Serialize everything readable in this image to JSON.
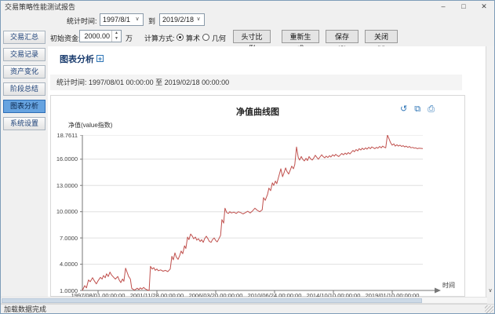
{
  "window": {
    "title": "交易策略性能测试报告",
    "controls": {
      "minimize": "–",
      "maximize": "□",
      "close": "✕"
    },
    "status": "加载数据完成"
  },
  "toolbar": {
    "stat_time_label": "统计时间:",
    "date_from": "1997/8/1",
    "to_label": "到",
    "date_to": "2019/2/18",
    "chevron": "∨",
    "initial_capital_label": "初始资金:",
    "initial_capital_value": "2000.00",
    "unit_label": "万",
    "calc_method_label": "计算方式:",
    "radio_arithmetic": "算术",
    "radio_geometric": "几何",
    "buttons": {
      "position_ratio": "头寸比例",
      "regenerate": "重新生成",
      "save": "保存(S)",
      "close": "关闭(X)"
    }
  },
  "sidebar": {
    "items": [
      {
        "label": "交易汇总",
        "selected": false
      },
      {
        "label": "交易记录",
        "selected": false
      },
      {
        "label": "资产变化",
        "selected": false
      },
      {
        "label": "阶段总结",
        "selected": false
      },
      {
        "label": "图表分析",
        "selected": true
      },
      {
        "label": "系统设置",
        "selected": false
      }
    ]
  },
  "main": {
    "section_title": "图表分析",
    "section_icon": "+",
    "stat_range": "统计时间: 1997/08/01 00:00:00 至 2019/02/18 00:00:00",
    "chart_icons": {
      "undo": "↺",
      "export": "⧉",
      "print": "⎙"
    }
  },
  "chart_data": {
    "type": "line",
    "title": "净值曲线图",
    "xlabel": "时间",
    "ylabel": "净值(value指数)",
    "x_tick_labels": [
      "1997/08/01 00:00:00",
      "2001/11/28 00:00:00",
      "2006/03/20 00:00:00",
      "2010/06/24 00:00:00",
      "2014/10/10 00:00:00",
      "2019/01/10 00:00:00"
    ],
    "y_ticks": [
      "1.0000",
      "4.0000",
      "7.0000",
      "10.0000",
      "13.0000",
      "16.0000",
      "18.7611"
    ],
    "ylim": [
      1.0,
      18.7611
    ],
    "grid": true,
    "legend": "none",
    "line_color": "#c0504d",
    "series": [
      {
        "name": "净值",
        "points": [
          [
            0.0,
            1.0
          ],
          [
            0.007,
            1.55
          ],
          [
            0.012,
            1.3
          ],
          [
            0.018,
            2.2
          ],
          [
            0.023,
            2.0
          ],
          [
            0.03,
            2.45
          ],
          [
            0.035,
            2.1
          ],
          [
            0.041,
            1.75
          ],
          [
            0.046,
            2.1
          ],
          [
            0.053,
            2.5
          ],
          [
            0.058,
            2.3
          ],
          [
            0.062,
            2.7
          ],
          [
            0.067,
            2.45
          ],
          [
            0.071,
            2.9
          ],
          [
            0.076,
            2.6
          ],
          [
            0.081,
            3.1
          ],
          [
            0.085,
            2.8
          ],
          [
            0.092,
            2.5
          ],
          [
            0.097,
            2.3
          ],
          [
            0.104,
            2.6
          ],
          [
            0.108,
            2.2
          ],
          [
            0.113,
            1.9
          ],
          [
            0.118,
            2.3
          ],
          [
            0.122,
            2.05
          ],
          [
            0.127,
            3.55
          ],
          [
            0.131,
            3.1
          ],
          [
            0.136,
            2.6
          ],
          [
            0.141,
            2.3
          ],
          [
            0.145,
            1.25
          ],
          [
            0.15,
            1.1
          ],
          [
            0.154,
            1.05
          ],
          [
            0.161,
            1.25
          ],
          [
            0.166,
            1.1
          ],
          [
            0.17,
            1.3
          ],
          [
            0.175,
            1.15
          ],
          [
            0.18,
            1.35
          ],
          [
            0.184,
            1.2
          ],
          [
            0.191,
            1.05
          ],
          [
            0.196,
            1.0
          ],
          [
            0.2,
            3.75
          ],
          [
            0.205,
            3.45
          ],
          [
            0.21,
            3.6
          ],
          [
            0.214,
            3.3
          ],
          [
            0.219,
            3.45
          ],
          [
            0.223,
            3.25
          ],
          [
            0.23,
            3.35
          ],
          [
            0.237,
            3.2
          ],
          [
            0.244,
            3.3
          ],
          [
            0.251,
            3.15
          ],
          [
            0.258,
            3.45
          ],
          [
            0.263,
            4.9
          ],
          [
            0.267,
            4.5
          ],
          [
            0.272,
            5.3
          ],
          [
            0.276,
            4.8
          ],
          [
            0.281,
            4.55
          ],
          [
            0.286,
            5.0
          ],
          [
            0.29,
            5.5
          ],
          [
            0.295,
            5.2
          ],
          [
            0.3,
            6.1
          ],
          [
            0.304,
            5.8
          ],
          [
            0.309,
            7.1
          ],
          [
            0.313,
            6.8
          ],
          [
            0.318,
            7.45
          ],
          [
            0.323,
            7.2
          ],
          [
            0.327,
            6.9
          ],
          [
            0.332,
            7.1
          ],
          [
            0.336,
            6.75
          ],
          [
            0.341,
            6.9
          ],
          [
            0.346,
            6.6
          ],
          [
            0.35,
            6.8
          ],
          [
            0.355,
            6.5
          ],
          [
            0.359,
            6.9
          ],
          [
            0.364,
            7.2
          ],
          [
            0.369,
            6.9
          ],
          [
            0.373,
            6.6
          ],
          [
            0.378,
            6.5
          ],
          [
            0.382,
            6.8
          ],
          [
            0.387,
            7.0
          ],
          [
            0.392,
            6.7
          ],
          [
            0.396,
            6.55
          ],
          [
            0.401,
            6.9
          ],
          [
            0.406,
            7.3
          ],
          [
            0.41,
            9.1
          ],
          [
            0.415,
            8.7
          ],
          [
            0.419,
            10.4
          ],
          [
            0.424,
            9.9
          ],
          [
            0.429,
            9.8
          ],
          [
            0.433,
            10.0
          ],
          [
            0.438,
            9.85
          ],
          [
            0.445,
            9.95
          ],
          [
            0.452,
            9.8
          ],
          [
            0.458,
            10.0
          ],
          [
            0.465,
            9.9
          ],
          [
            0.472,
            9.75
          ],
          [
            0.479,
            9.9
          ],
          [
            0.486,
            10.05
          ],
          [
            0.493,
            9.85
          ],
          [
            0.5,
            10.1
          ],
          [
            0.507,
            10.4
          ],
          [
            0.514,
            10.15
          ],
          [
            0.521,
            10.0
          ],
          [
            0.528,
            10.2
          ],
          [
            0.532,
            11.6
          ],
          [
            0.537,
            11.3
          ],
          [
            0.544,
            12.0
          ],
          [
            0.548,
            12.7
          ],
          [
            0.553,
            12.4
          ],
          [
            0.558,
            13.3
          ],
          [
            0.562,
            13.0
          ],
          [
            0.567,
            13.5
          ],
          [
            0.571,
            13.2
          ],
          [
            0.578,
            14.2
          ],
          [
            0.583,
            14.9
          ],
          [
            0.588,
            14.0
          ],
          [
            0.592,
            14.4
          ],
          [
            0.597,
            15.0
          ],
          [
            0.601,
            14.6
          ],
          [
            0.606,
            14.3
          ],
          [
            0.611,
            14.8
          ],
          [
            0.615,
            15.2
          ],
          [
            0.62,
            14.9
          ],
          [
            0.624,
            15.4
          ],
          [
            0.629,
            17.4
          ],
          [
            0.634,
            16.2
          ],
          [
            0.638,
            15.9
          ],
          [
            0.643,
            16.3
          ],
          [
            0.647,
            16.0
          ],
          [
            0.652,
            15.8
          ],
          [
            0.657,
            16.1
          ],
          [
            0.661,
            15.85
          ],
          [
            0.666,
            16.3
          ],
          [
            0.67,
            16.05
          ],
          [
            0.675,
            15.9
          ],
          [
            0.68,
            16.15
          ],
          [
            0.684,
            16.45
          ],
          [
            0.689,
            16.2
          ],
          [
            0.693,
            16.0
          ],
          [
            0.698,
            16.25
          ],
          [
            0.703,
            16.5
          ],
          [
            0.707,
            16.3
          ],
          [
            0.712,
            16.15
          ],
          [
            0.716,
            16.35
          ],
          [
            0.721,
            16.2
          ],
          [
            0.726,
            16.4
          ],
          [
            0.73,
            16.25
          ],
          [
            0.735,
            16.5
          ],
          [
            0.74,
            16.35
          ],
          [
            0.744,
            16.55
          ],
          [
            0.749,
            16.4
          ],
          [
            0.753,
            16.3
          ],
          [
            0.758,
            16.5
          ],
          [
            0.762,
            16.65
          ],
          [
            0.767,
            16.5
          ],
          [
            0.772,
            16.7
          ],
          [
            0.776,
            16.55
          ],
          [
            0.781,
            16.75
          ],
          [
            0.786,
            16.6
          ],
          [
            0.79,
            16.8
          ],
          [
            0.795,
            17.0
          ],
          [
            0.799,
            16.85
          ],
          [
            0.804,
            17.1
          ],
          [
            0.809,
            16.95
          ],
          [
            0.813,
            17.2
          ],
          [
            0.818,
            17.05
          ],
          [
            0.822,
            17.25
          ],
          [
            0.827,
            17.1
          ],
          [
            0.832,
            17.3
          ],
          [
            0.836,
            17.15
          ],
          [
            0.841,
            17.35
          ],
          [
            0.846,
            17.2
          ],
          [
            0.85,
            17.4
          ],
          [
            0.855,
            17.3
          ],
          [
            0.859,
            17.2
          ],
          [
            0.864,
            17.35
          ],
          [
            0.868,
            17.25
          ],
          [
            0.873,
            17.45
          ],
          [
            0.878,
            17.3
          ],
          [
            0.882,
            17.5
          ],
          [
            0.887,
            17.35
          ],
          [
            0.891,
            17.3
          ],
          [
            0.896,
            18.76
          ],
          [
            0.901,
            18.3
          ],
          [
            0.905,
            17.9
          ],
          [
            0.91,
            17.6
          ],
          [
            0.915,
            17.75
          ],
          [
            0.919,
            17.5
          ],
          [
            0.924,
            17.65
          ],
          [
            0.928,
            17.5
          ],
          [
            0.933,
            17.6
          ],
          [
            0.938,
            17.45
          ],
          [
            0.942,
            17.55
          ],
          [
            0.947,
            17.4
          ],
          [
            0.951,
            17.5
          ],
          [
            0.956,
            17.35
          ],
          [
            0.961,
            17.45
          ],
          [
            0.965,
            17.3
          ],
          [
            0.97,
            17.35
          ],
          [
            0.975,
            17.25
          ],
          [
            0.979,
            17.3
          ],
          [
            0.984,
            17.2
          ],
          [
            0.988,
            17.25
          ],
          [
            1.0,
            17.22
          ]
        ]
      }
    ]
  }
}
